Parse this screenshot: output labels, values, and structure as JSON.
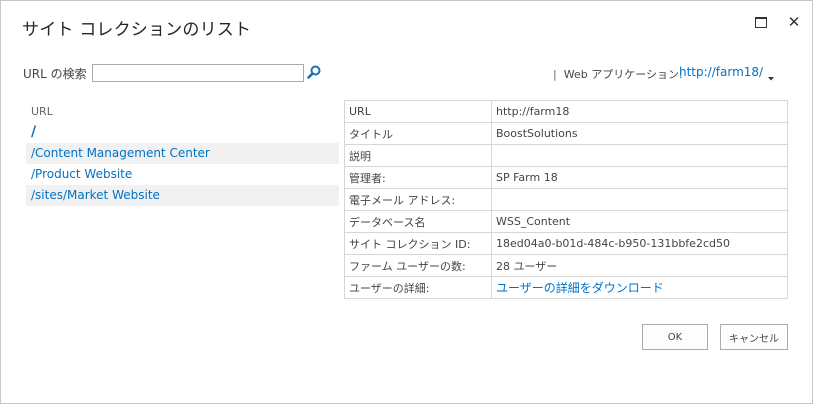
{
  "dialog": {
    "title": "サイト コレクションのリスト"
  },
  "search": {
    "label": "URL の検索",
    "value": "",
    "placeholder": ""
  },
  "web_app": {
    "separator": "|",
    "label": "Web アプリケーション:",
    "value": "http://farm18/"
  },
  "site_list": {
    "header": "URL",
    "items": [
      {
        "label": "/"
      },
      {
        "label": "/Content Management Center"
      },
      {
        "label": "/Product Website"
      },
      {
        "label": "/sites/Market Website"
      }
    ]
  },
  "details": {
    "rows": [
      {
        "key": "URL",
        "value": "http://farm18"
      },
      {
        "key": "タイトル",
        "value": "BoostSolutions"
      },
      {
        "key": "説明",
        "value": ""
      },
      {
        "key": "管理者:",
        "value": "SP Farm 18"
      },
      {
        "key": "電子メール アドレス:",
        "value": ""
      },
      {
        "key": "データベース名",
        "value": "WSS_Content"
      },
      {
        "key": "サイト コレクション ID:",
        "value": "18ed04a0-b01d-484c-b950-131bbfe2cd50"
      },
      {
        "key": "ファーム ユーザーの数:",
        "value": "28 ユーザー"
      },
      {
        "key": "ユーザーの詳細:",
        "value": "ユーザーの詳細をダウンロード"
      }
    ]
  },
  "buttons": {
    "ok": "OK",
    "cancel": "キャンセル"
  },
  "colors": {
    "link": "#0072c6",
    "alt_row": "#f1f1f1",
    "border": "#d6d6d6"
  }
}
